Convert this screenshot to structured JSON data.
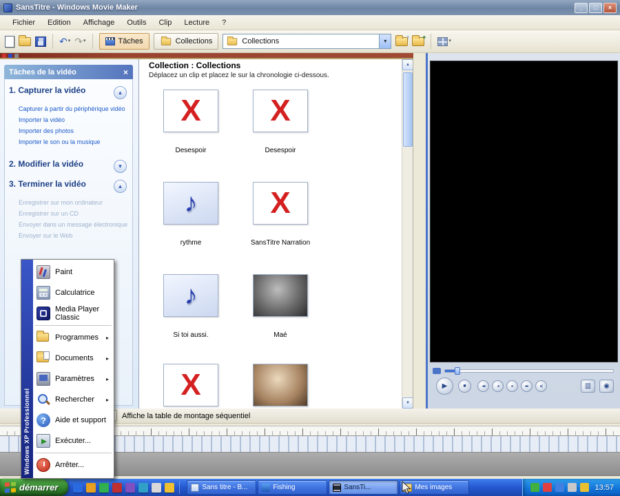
{
  "titlebar": {
    "title": "SansTitre - Windows Movie Maker",
    "minimize": "_",
    "maximize": "□",
    "close": "×"
  },
  "menubar": {
    "items": [
      "Fichier",
      "Edition",
      "Affichage",
      "Outils",
      "Clip",
      "Lecture",
      "?"
    ]
  },
  "toolbar": {
    "tasks_label": "Tâches",
    "collections_label": "Collections",
    "combo_value": "Collections"
  },
  "icons": {
    "undo": "↶",
    "redo": "↷",
    "small_dropdown": "▾",
    "dropdown": "▼",
    "close": "×",
    "chevron_up": "▲",
    "chevron_down": "▼",
    "scroll_up": "▲",
    "scroll_down": "▼",
    "missing_clip": "X",
    "audio_note": "♪",
    "play": "▶",
    "stop": "■",
    "seek_back": "◂◂",
    "step_back": "◂",
    "step_forward": "▸",
    "seek_forward": "▸▸",
    "step_end": "▸|",
    "split": "▥",
    "snapshot": "◉",
    "submenu": "▸",
    "help_q": "?",
    "up_level": "↑",
    "new_collection": "+"
  },
  "tasks_panel": {
    "title": "Tâches de la vidéo",
    "sections": [
      {
        "title": "1. Capturer la vidéo"
      },
      {
        "title": "2. Modifier la vidéo"
      },
      {
        "title": "3. Terminer la vidéo"
      }
    ],
    "capture_links": [
      "Capturer à partir du périphérique vidéo",
      "Importer la vidéo",
      "Importer des photos",
      "Importer le son ou la musique"
    ],
    "finish_links": [
      "Enregistrer sur mon ordinateur",
      "Enregistrer sur un CD",
      "Envoyer dans un message électronique",
      "Envoyer sur le Web"
    ]
  },
  "collections": {
    "title": "Collection : Collections",
    "subtitle": "Déplacez un clip et placez le sur la chronologie ci-dessous.",
    "clips": [
      {
        "label": "Desespoir"
      },
      {
        "label": "Desespoir"
      },
      {
        "label": "rythme"
      },
      {
        "label": "SansTitre Narration"
      },
      {
        "label": "Si toi aussi."
      },
      {
        "label": "Maé"
      },
      {
        "label": ""
      },
      {
        "label": ""
      }
    ]
  },
  "timeline": {
    "bar_label": "Affiche la table de montage séquentiel"
  },
  "start_menu": {
    "side_text": "Windows XP Professionnel",
    "pinned": [
      "Paint",
      "Calculatrice",
      "Media Player Classic"
    ],
    "items": [
      "Programmes",
      "Documents",
      "Paramètres",
      "Rechercher",
      "Aide et support",
      "Exécuter..."
    ],
    "shutdown": "Arrêter..."
  },
  "taskbar": {
    "start_label": "démarrer",
    "buttons": [
      {
        "label": "Sans titre - B..."
      },
      {
        "label": "Fishing"
      },
      {
        "label": "SansTi..."
      },
      {
        "label": "Mes images"
      }
    ],
    "clock": "13:57"
  }
}
